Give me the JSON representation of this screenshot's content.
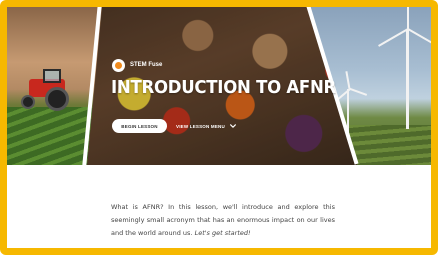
{
  "hero": {
    "brand": "STEM Fuse",
    "title": "INTRODUCTION TO AFNR",
    "begin_label": "BEGIN LESSON",
    "menu_label": "VIEW LESSON MENU"
  },
  "intro": {
    "text": "What is AFNR? In this lesson, we'll introduce and explore this seemingly small acronym that has an enormous impact on our lives and the world around us.",
    "cta": "Let's get started!"
  },
  "colors": {
    "frame": "#f6b800",
    "brand_logo": "#f08a1c"
  },
  "icons": {
    "brand": "stem-fuse-logo-icon",
    "menu": "chevron-down-icon"
  }
}
